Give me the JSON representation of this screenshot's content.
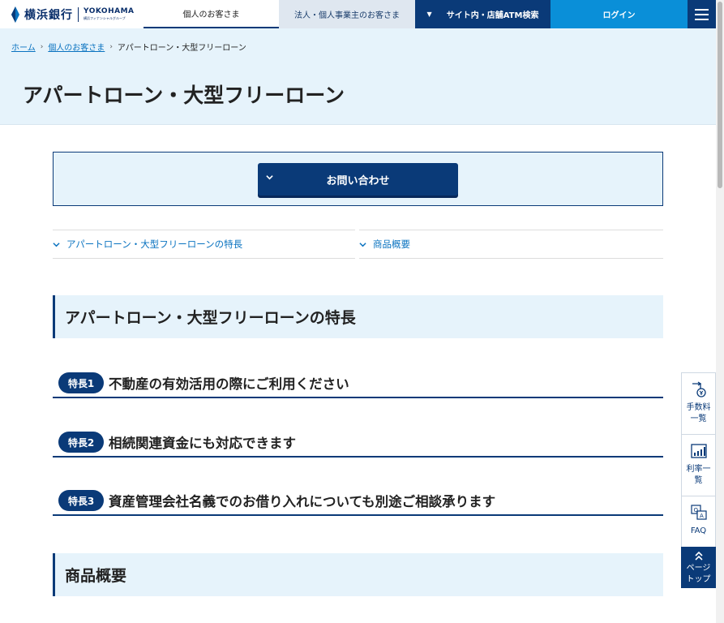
{
  "header": {
    "logo_jp": "横浜銀行",
    "logo_en": "YOKOHAMA",
    "logo_en_sub": "横浜フィナンシャルグループ",
    "tabs": {
      "personal": "個人のお客さま",
      "corporate": "法人・個人事業主のお客さま",
      "search": "サイト内・店舗ATM検索",
      "login": "ログイン"
    },
    "colors": {
      "navy": "#0a3a78",
      "login_blue": "#0a8fd8",
      "light_bg": "#e6f3fb"
    }
  },
  "breadcrumb": {
    "items": [
      "ホーム",
      "個人のお客さま",
      "アパートローン・大型フリーローン"
    ]
  },
  "page_title": "アパートローン・大型フリーローン",
  "contact": {
    "button_label": "お問い合わせ"
  },
  "anchors": [
    "アパートローン・大型フリーローンの特長",
    "商品概要"
  ],
  "sections": {
    "features_heading": "アパートローン・大型フリーローンの特長",
    "overview_heading": "商品概要"
  },
  "features": [
    {
      "badge": "特長1",
      "title": "不動産の有効活用の際にご利用ください"
    },
    {
      "badge": "特長2",
      "title": "相続関連資金にも対応できます"
    },
    {
      "badge": "特長3",
      "title": "資産管理会社名義でのお借り入れについても別途ご相談承ります"
    }
  ],
  "sidenav": {
    "fees": "手数料一覧",
    "rates": "利率一覧",
    "faq": "FAQ",
    "page_top": "ページトップ"
  }
}
